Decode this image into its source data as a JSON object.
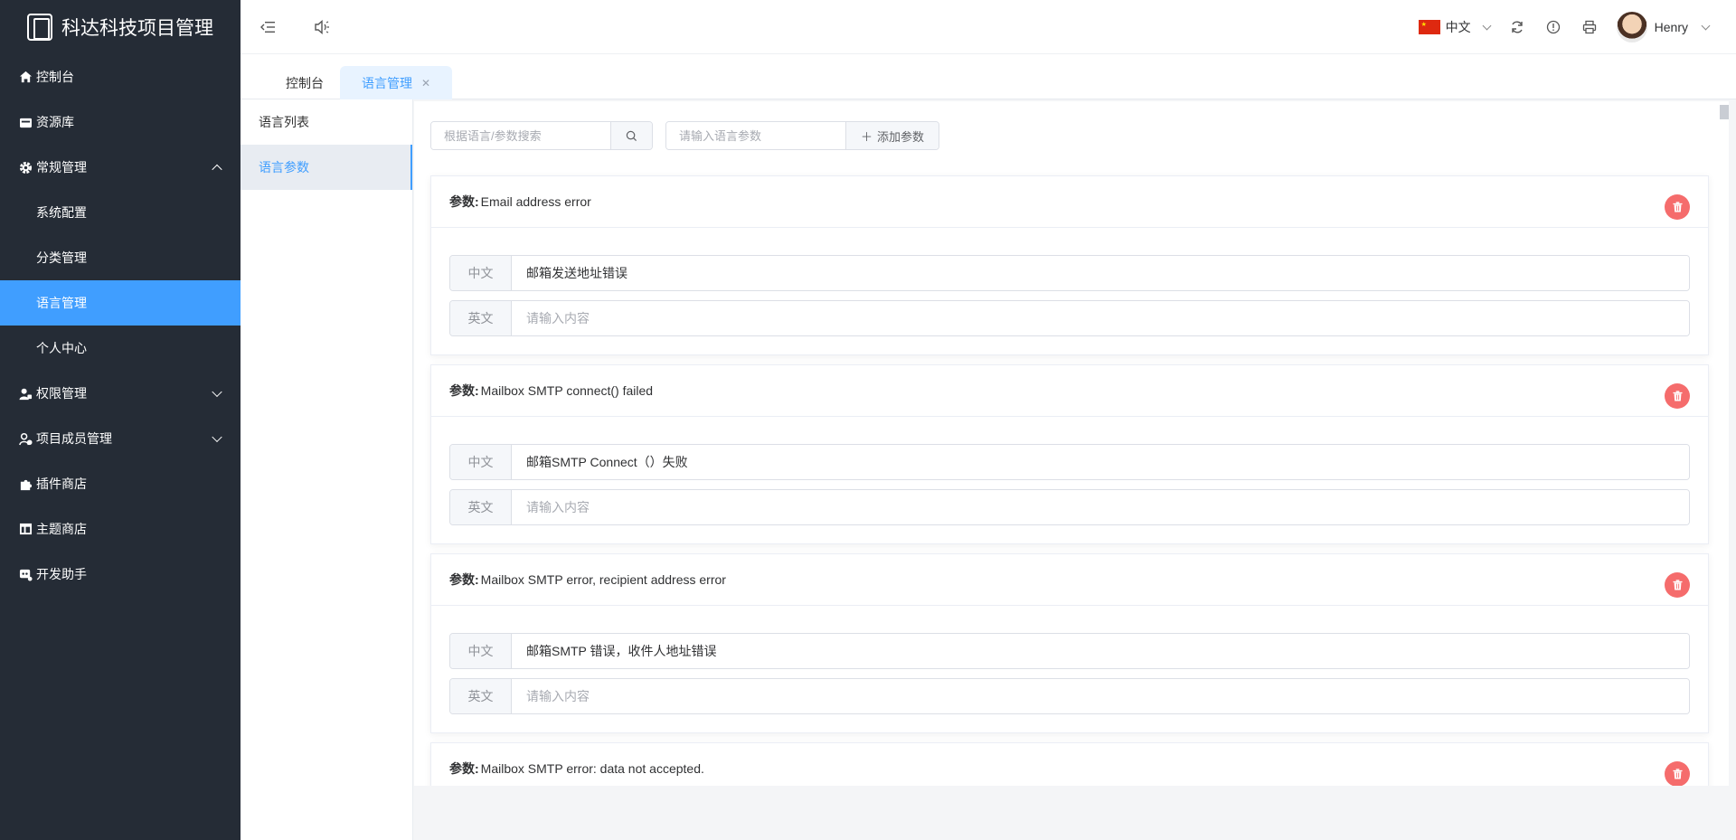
{
  "app": {
    "title": "科达科技项目管理"
  },
  "sidebar": {
    "items": [
      {
        "label": "控制台",
        "icon": "home-icon"
      },
      {
        "label": "资源库",
        "icon": "folder-icon"
      },
      {
        "label": "常规管理",
        "icon": "gear-icon",
        "expanded": true
      },
      {
        "label": "系统配置",
        "sub": true
      },
      {
        "label": "分类管理",
        "sub": true
      },
      {
        "label": "语言管理",
        "sub": true,
        "active": true
      },
      {
        "label": "个人中心",
        "sub": true
      },
      {
        "label": "权限管理",
        "icon": "user-lock-icon",
        "expanded": false
      },
      {
        "label": "项目成员管理",
        "icon": "member-icon",
        "expanded": false
      },
      {
        "label": "插件商店",
        "icon": "puzzle-icon"
      },
      {
        "label": "主题商店",
        "icon": "layout-icon"
      },
      {
        "label": "开发助手",
        "icon": "robot-icon"
      }
    ]
  },
  "header": {
    "language": "中文",
    "username": "Henry"
  },
  "tabs": [
    {
      "label": "控制台"
    },
    {
      "label": "语言管理",
      "active": true
    }
  ],
  "subnav": [
    {
      "label": "语言列表"
    },
    {
      "label": "语言参数",
      "active": true
    }
  ],
  "toolbar": {
    "search_placeholder": "根据语言/参数搜索",
    "param_placeholder": "请输入语言参数",
    "add_label": "添加参数"
  },
  "cards": {
    "param_label": "参数:",
    "zh_label": "中文",
    "en_label": "英文",
    "empty_placeholder": "请输入内容",
    "items": [
      {
        "param": "Email address error",
        "zh": "邮箱发送地址错误",
        "en": ""
      },
      {
        "param": "Mailbox SMTP connect() failed",
        "zh": "邮箱SMTP Connect（）失败",
        "en": ""
      },
      {
        "param": "Mailbox SMTP error, recipient address error",
        "zh": "邮箱SMTP 错误，收件人地址错误",
        "en": ""
      },
      {
        "param": "Mailbox SMTP error: data not accepted.",
        "zh": "",
        "en": ""
      }
    ]
  },
  "colors": {
    "accent": "#409eff",
    "sidebar_bg": "#252c36",
    "danger": "#f56c6c"
  }
}
